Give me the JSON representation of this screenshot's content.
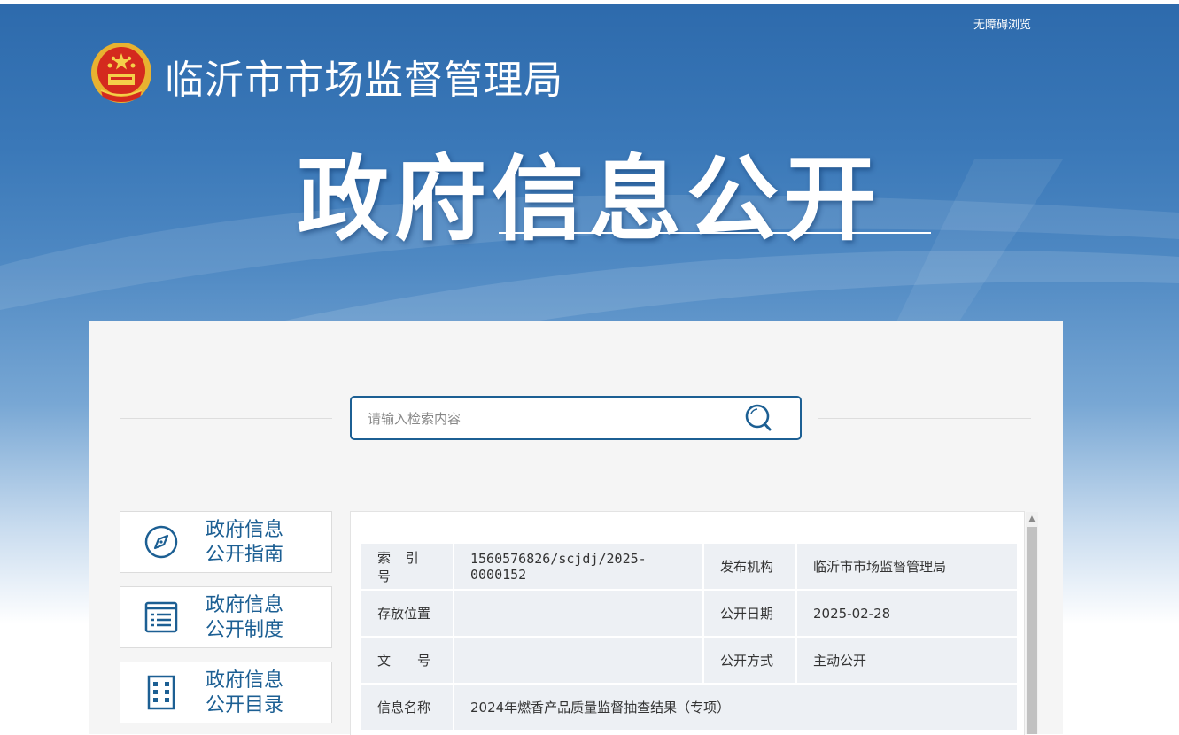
{
  "header": {
    "accessibility_link": "无障碍浏览",
    "site_name": "临沂市市场监督管理局",
    "section_title": "政府信息公开"
  },
  "search": {
    "placeholder": "请输入检索内容"
  },
  "sidebar": {
    "items": [
      {
        "label_line1": "政府信息",
        "label_line2": "公开指南",
        "icon": "compass-icon"
      },
      {
        "label_line1": "政府信息",
        "label_line2": "公开制度",
        "icon": "document-list-icon"
      },
      {
        "label_line1": "政府信息",
        "label_line2": "公开目录",
        "icon": "catalog-grid-icon"
      }
    ]
  },
  "info_table": {
    "rows": [
      {
        "k1": "索 引 号",
        "v1": "1560576826/scjdj/2025-0000152",
        "k2": "发布机构",
        "v2": "临沂市市场监督管理局"
      },
      {
        "k1": "存放位置",
        "v1": "",
        "k2": "公开日期",
        "v2": "2025-02-28"
      },
      {
        "k1": "文　　号",
        "v1": "",
        "k2": "公开方式",
        "v2": "主动公开"
      },
      {
        "k1": "信息名称",
        "v1": "2024年燃香产品质量监督抽查结果（专项）"
      }
    ]
  },
  "colors": {
    "brand_blue": "#1c5f93",
    "banner_top": "#2d6aac",
    "table_cell": "#edf0f4"
  }
}
